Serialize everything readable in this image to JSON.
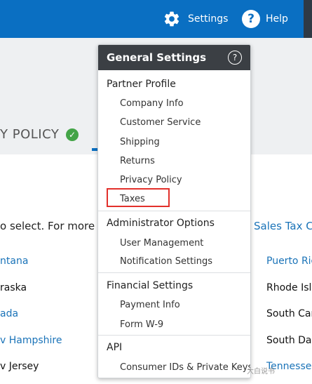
{
  "topbar": {
    "settings_label": "Settings",
    "help_label": "Help",
    "help_glyph": "?",
    "settings_icon": "gear-icon",
    "help_icon": "help-icon",
    "color": "#0a6fc2"
  },
  "background": {
    "policy_tab": "Y POLICY",
    "policy_check_icon": "check-circle-icon",
    "policy_check_color": "#43a447",
    "select_text": "o select. For more i",
    "tax_link": "Sales Tax C",
    "states_left": [
      {
        "label": "ntana",
        "link": true
      },
      {
        "label": "raska",
        "link": false
      },
      {
        "label": "ada",
        "link": true
      },
      {
        "label": "v Hampshire",
        "link": true
      },
      {
        "label": "v Jersey",
        "link": false
      }
    ],
    "states_right": [
      {
        "label": "Puerto Ric",
        "link": true
      },
      {
        "label": "Rhode Isla",
        "link": false
      },
      {
        "label": "South Car",
        "link": false
      },
      {
        "label": "South Dal",
        "link": false
      },
      {
        "label": "Tennesse",
        "link": true
      }
    ]
  },
  "dropdown": {
    "title": "General Settings",
    "help_glyph": "?",
    "sections": [
      {
        "title": "Partner Profile",
        "items": [
          "Company Info",
          "Customer Service",
          "Shipping",
          "Returns",
          "Privacy Policy",
          "Taxes"
        ]
      },
      {
        "title": "Administrator Options",
        "items": [
          "User Management",
          "Notification Settings"
        ]
      },
      {
        "title": "Financial Settings",
        "items": [
          "Payment Info",
          "Form W-9"
        ]
      },
      {
        "title": "API",
        "items": [
          "Consumer IDs & Private Keys"
        ]
      }
    ],
    "highlighted_item": "Taxes",
    "highlight_color": "#e2302b"
  },
  "watermark": "大白说书"
}
